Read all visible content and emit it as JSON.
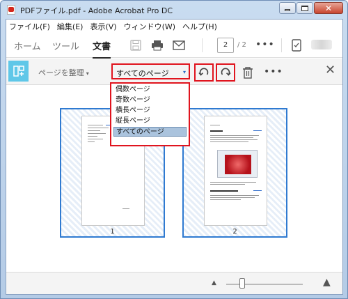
{
  "window": {
    "title": "PDFファイル.pdf - Adobe Acrobat Pro DC"
  },
  "menu": [
    "ファイル(F)",
    "編集(E)",
    "表示(V)",
    "ウィンドウ(W)",
    "ヘルプ(H)"
  ],
  "nav_tabs": {
    "home": "ホーム",
    "tools": "ツール",
    "document": "文書"
  },
  "toolbar": {
    "icons": [
      "save-icon",
      "print-icon",
      "mail-icon",
      "more-icon",
      "mobile-icon",
      "user-icon"
    ],
    "current_page": "2",
    "page_total": "/ 2",
    "more": "•••"
  },
  "organize": {
    "label": "ページを整理",
    "caret": "▾",
    "select_value": "すべてのページ",
    "select_caret": "▾",
    "more": "•••",
    "close": "✕",
    "options": [
      "偶数ページ",
      "奇数ページ",
      "横長ページ",
      "縦長ページ",
      "すべてのページ"
    ],
    "selected_option": "すべてのページ"
  },
  "thumbnails": [
    {
      "page_number": "1"
    },
    {
      "page_number": "2"
    }
  ],
  "zoom": {
    "small_icon": "▲",
    "large_icon": "▲",
    "slider_level": 0.2
  },
  "colors": {
    "accent_red": "#e0141e",
    "selection_blue": "#2f7ad1",
    "organize_tool_cyan": "#5fc7e8"
  }
}
